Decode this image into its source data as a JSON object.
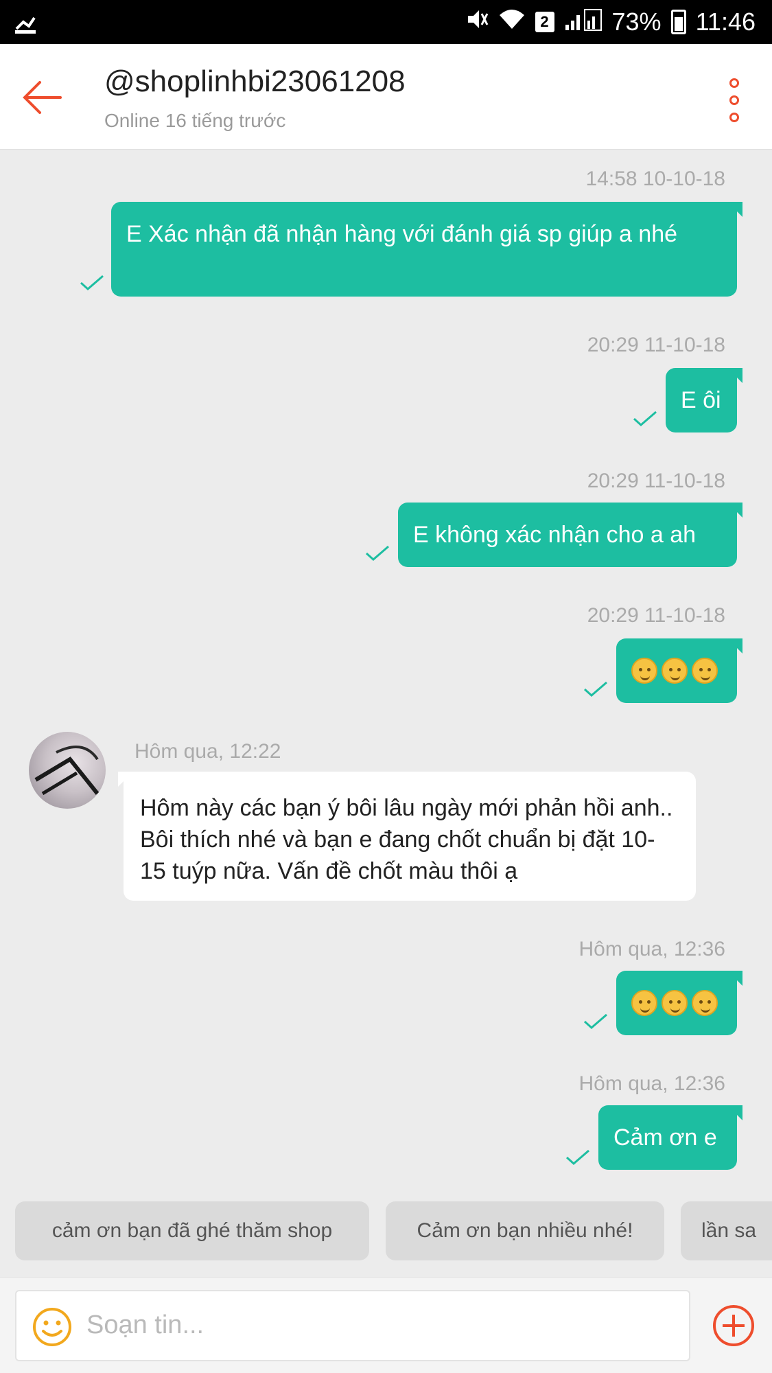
{
  "status_bar": {
    "battery": "73%",
    "time": "11:46",
    "sim_slot": "2"
  },
  "header": {
    "title": "@shoplinhbi23061208",
    "subtitle": "Online 16 tiếng trước"
  },
  "messages": [
    {
      "timestamp": "14:58 10-10-18",
      "direction": "outgoing",
      "text": "E Xác nhận đã nhận hàng với đánh giá sp giúp a nhé"
    },
    {
      "timestamp": "20:29 11-10-18",
      "direction": "outgoing",
      "text": "E ôi"
    },
    {
      "timestamp": "20:29 11-10-18",
      "direction": "outgoing",
      "text": "E không xác nhận cho a ah"
    },
    {
      "timestamp": "20:29 11-10-18",
      "direction": "outgoing",
      "emoji": [
        "smiley-icon",
        "smiley-icon",
        "smiley-icon"
      ]
    },
    {
      "timestamp": "Hôm qua, 12:22",
      "direction": "incoming",
      "text": "Hôm này các bạn ý bôi lâu ngày mới phản hồi anh.. Bôi thích nhé và bạn e đang chốt chuẩn bị đặt 10-15 tuýp nữa. Vấn đề chốt màu thôi ạ"
    },
    {
      "timestamp": "Hôm qua, 12:36",
      "direction": "outgoing",
      "emoji": [
        "smiley-icon",
        "smiley-icon",
        "smiley-icon"
      ]
    },
    {
      "timestamp": "Hôm qua, 12:36",
      "direction": "outgoing",
      "text": "Cảm ơn e"
    }
  ],
  "quick_replies": [
    "cảm ơn bạn đã ghé thăm shop",
    "Cảm ơn bạn nhiều nhé!",
    "lần sa"
  ],
  "composer": {
    "placeholder": "Soạn tin..."
  },
  "colors": {
    "accent": "#ee4d2d",
    "outgoing_bubble": "#1dbea1",
    "background": "#ececec"
  }
}
